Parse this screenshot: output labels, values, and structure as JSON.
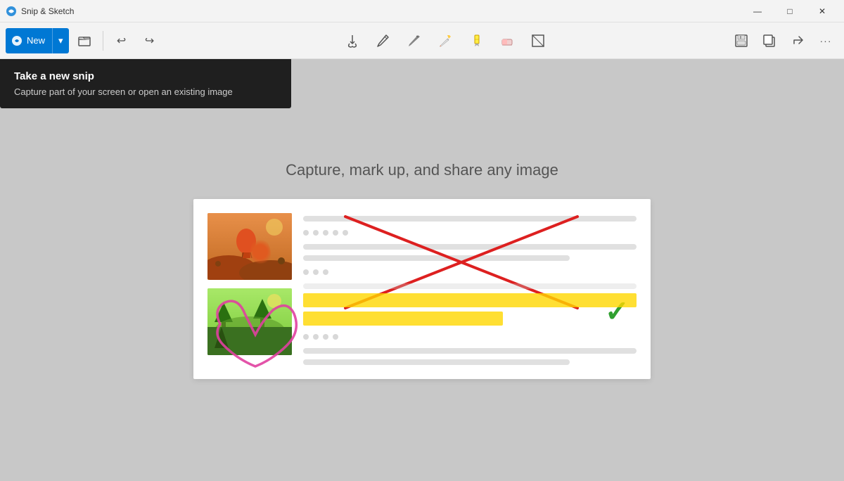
{
  "titleBar": {
    "icon": "✂",
    "title": "Snip & Sketch",
    "minimize": "—",
    "maximize": "□",
    "close": "✕"
  },
  "toolbar": {
    "newLabel": "New",
    "newArrow": "▾",
    "undoIcon": "↩",
    "redoIcon": "↪",
    "touchIcon": "✋",
    "pencilIcon": "✏",
    "highlighterIcon": "⬟",
    "eraserIcon": "◈",
    "cropIcon": "⊞",
    "saveIcon": "💾",
    "copyIcon": "⎘",
    "shareIcon": "↗",
    "moreIcon": "···"
  },
  "tooltip": {
    "title": "Take a new snip",
    "description": "Capture part of your screen or open an existing image"
  },
  "main": {
    "heading": "Capture, mark up, and share any image"
  }
}
